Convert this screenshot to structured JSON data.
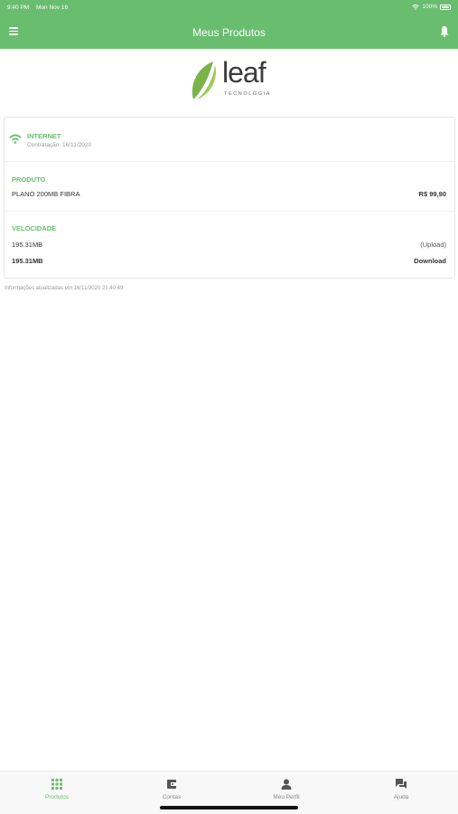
{
  "status_bar": {
    "time": "9:40 PM",
    "date": "Mon Nov 16",
    "battery": "100%"
  },
  "header": {
    "title": "Meus Produtos"
  },
  "logo": {
    "word": "leaf",
    "subtitle": "TECNOLOGIA"
  },
  "service": {
    "name": "INTERNET",
    "contract_date": "Contratação: 16/11/2020"
  },
  "product": {
    "section_title": "PRODUTO",
    "plan": "PLANO 200MB FIBRA",
    "price": "R$ 99,90"
  },
  "speed": {
    "section_title": "VELOCIDADE",
    "upload_value": "195.31MB",
    "upload_label": "(Upload)",
    "download_value": "195.31MB",
    "download_label": "Download"
  },
  "updated_text": "Informações atualizadas em 16/11/2020 21:40:49",
  "tabs": [
    {
      "label": "Produtos",
      "icon": "grid-icon"
    },
    {
      "label": "Contas",
      "icon": "wallet-icon"
    },
    {
      "label": "Meu Perfil",
      "icon": "user-icon"
    },
    {
      "label": "Ajuda",
      "icon": "chat-icon"
    }
  ],
  "colors": {
    "accent": "#69bd6f",
    "text": "#333333",
    "muted": "#999999"
  }
}
